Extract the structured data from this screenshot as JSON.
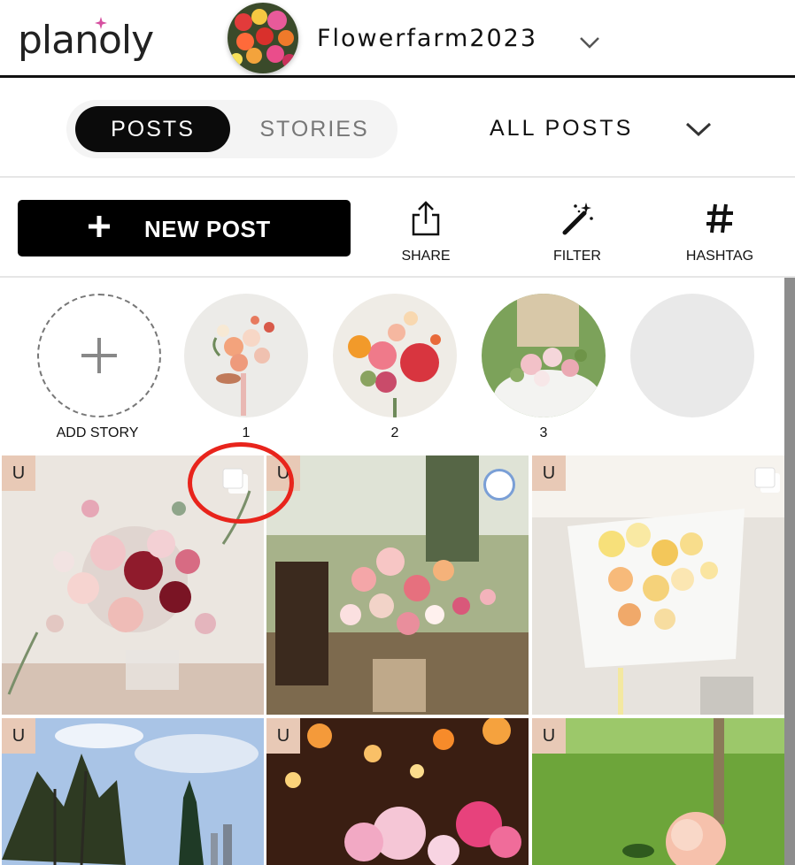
{
  "brand": {
    "logo_text": "planoly",
    "accent": "#d64fa0"
  },
  "account": {
    "name": "Flowerfarm2023"
  },
  "tabs": {
    "posts": "POSTS",
    "stories": "STORIES",
    "filter": "ALL POSTS"
  },
  "toolbar": {
    "new_post": "NEW POST",
    "share": "SHARE",
    "filter": "FILTER",
    "hashtag": "HASHTAG"
  },
  "stories": {
    "add": "ADD STORY",
    "items": [
      "1",
      "2",
      "3"
    ]
  },
  "grid": {
    "badge": "U",
    "tile_count": 6
  },
  "colors": {
    "primary": "#000000",
    "badge_bg": "#e8c9b6",
    "annotation": "#e8241c",
    "selection": "#7a9fd6"
  }
}
